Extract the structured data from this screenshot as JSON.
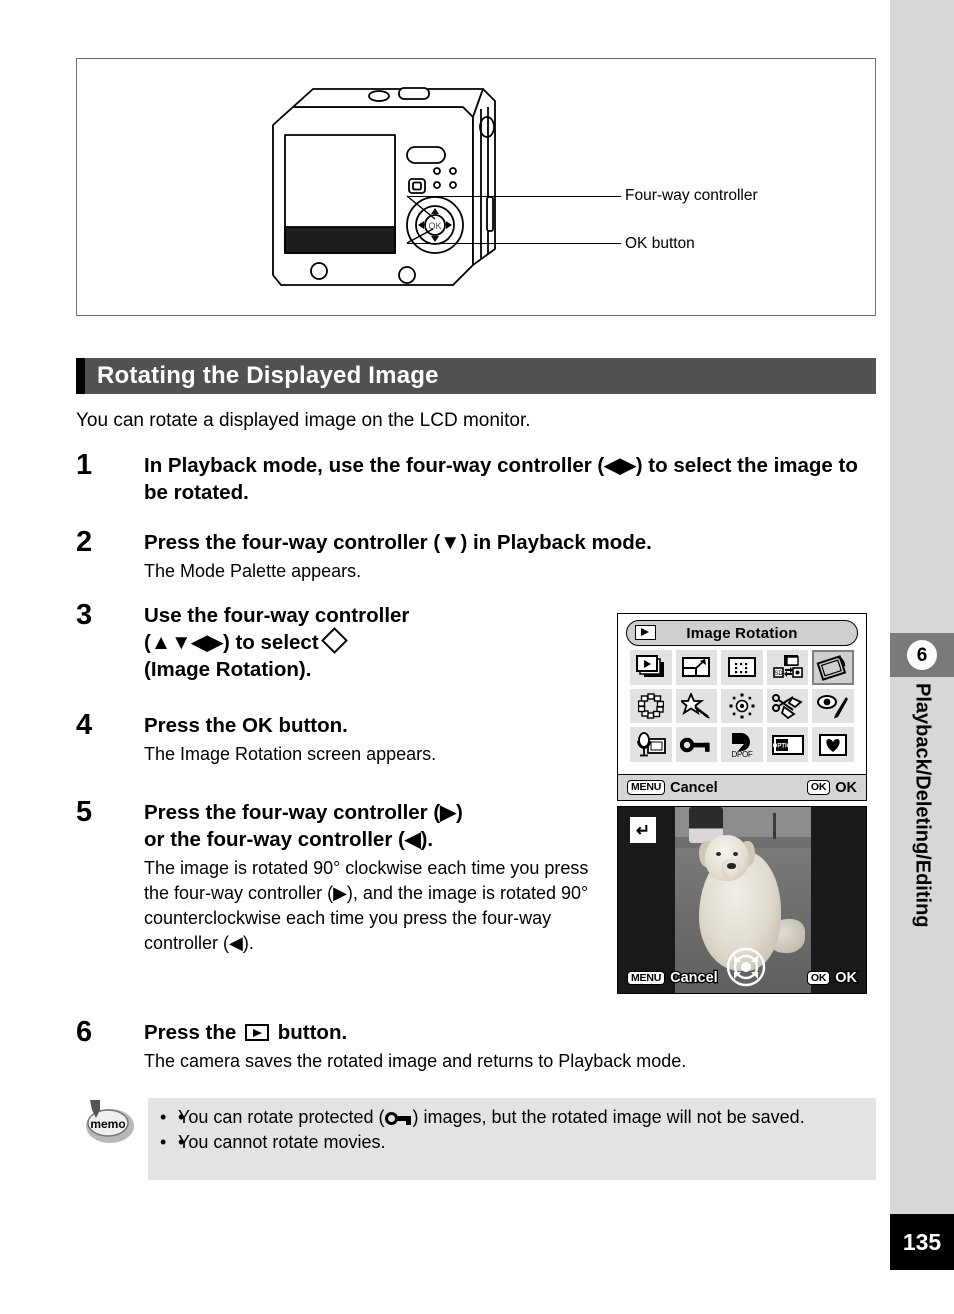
{
  "page": {
    "number": "135",
    "chapter_number": "6",
    "chapter_title": "Playback/Deleting/Editing"
  },
  "figure": {
    "camera_alt": "camera-rear-illustration",
    "callouts": [
      {
        "id": "four-way-controller",
        "label": "Four-way controller"
      },
      {
        "id": "ok-button",
        "label": "OK button"
      }
    ]
  },
  "section": {
    "heading": "Rotating the Displayed Image",
    "intro": "You can rotate a displayed image on the LCD monitor."
  },
  "steps": [
    {
      "number": "1",
      "title_parts": [
        "In Playback mode, use the four-way controller (",
        "◀▶",
        ") to select the image to be rotated."
      ],
      "title_plain": "In Playback mode, use the four-way controller (◀▶) to select the image to be rotated.",
      "desc": ""
    },
    {
      "number": "2",
      "title_plain": "Press the four-way controller (▼) in Playback mode.",
      "desc": "The Mode Palette appears."
    },
    {
      "number": "3",
      "title_plain": "Use the four-way controller (▲▼◀▶) to select ◇ (Image Rotation).",
      "title_line1": "Use the four-way controller",
      "title_line2_pre": "(",
      "title_line2_arrows": "▲▼◀▶",
      "title_line2_post": ") to select",
      "title_line3": "(Image Rotation).",
      "desc": ""
    },
    {
      "number": "4",
      "title_plain": "Press the OK button.",
      "desc": "The Image Rotation screen appears."
    },
    {
      "number": "5",
      "title_line1": "Press the four-way controller (▶)",
      "title_line2": "or the four-way controller (◀).",
      "title_plain": "Press the four-way controller (▶) or the four-way controller (◀).",
      "desc": "The image is rotated 90° clockwise each time you press the four-way controller (▶), and the image is rotated 90° counterclockwise each time you press the four-way controller (◀)."
    },
    {
      "number": "6",
      "title_pre": "Press the",
      "title_post": "button.",
      "title_plain": "Press the ▶ button.",
      "desc": "The camera saves the rotated image and returns to Playback mode."
    }
  ],
  "memo": {
    "icon_label": "memo",
    "items": [
      {
        "pre": "You can rotate protected (",
        "post": ") images, but the rotated image will not be saved.",
        "icon": "key-protect-icon"
      },
      {
        "pre": "You cannot rotate movies.",
        "post": "",
        "icon": ""
      }
    ]
  },
  "lcd_mode_palette": {
    "title": "Image Rotation",
    "title_icon": "playback-icon",
    "cancel_chip": "MENU",
    "cancel_label": "Cancel",
    "ok_chip": "OK",
    "ok_label": "OK",
    "icons": [
      {
        "name": "slideshow-icon",
        "row": 1,
        "col": 1,
        "selected": false
      },
      {
        "name": "resize-icon",
        "row": 1,
        "col": 2,
        "selected": false
      },
      {
        "name": "trim-icon",
        "row": 1,
        "col": 3,
        "selected": false
      },
      {
        "name": "image-copy-icon",
        "row": 1,
        "col": 4,
        "selected": false
      },
      {
        "name": "image-rotation-icon",
        "row": 1,
        "col": 5,
        "selected": true
      },
      {
        "name": "frame-composite-icon",
        "row": 2,
        "col": 1,
        "selected": false
      },
      {
        "name": "digital-filter-icon",
        "row": 2,
        "col": 2,
        "selected": false
      },
      {
        "name": "brightness-filter-icon",
        "row": 2,
        "col": 3,
        "selected": false
      },
      {
        "name": "image-cut-paste-icon",
        "row": 2,
        "col": 4,
        "selected": false
      },
      {
        "name": "red-eye-compensation-icon",
        "row": 2,
        "col": 5,
        "selected": false
      },
      {
        "name": "voice-memo-icon",
        "row": 3,
        "col": 1,
        "selected": false
      },
      {
        "name": "protect-icon",
        "row": 3,
        "col": 2,
        "selected": false
      },
      {
        "name": "dpof-icon",
        "row": 3,
        "col": 3,
        "selected": false
      },
      {
        "name": "start-screen-icon",
        "row": 3,
        "col": 4,
        "selected": false
      },
      {
        "name": "favorite-icon",
        "row": 3,
        "col": 5,
        "selected": false
      }
    ]
  },
  "lcd_rotation_screen": {
    "return_icon": "↵",
    "cancel_chip": "MENU",
    "cancel_label": "Cancel",
    "ok_chip": "OK",
    "ok_label": "OK",
    "dial_icon": "four-way-rotate-icon",
    "photo_alt": "golden-retriever-photo"
  },
  "colors": {
    "heading_bg": "#515151",
    "rail_bg": "#d7d7d7",
    "chapter_tab_bg": "#7a7a7a",
    "memo_bg": "#e3e3e3",
    "page_number_bg": "#000000",
    "lcd_cell_bg": "#e2e2e2",
    "lcd_selected_bg": "#cfcfcf"
  }
}
